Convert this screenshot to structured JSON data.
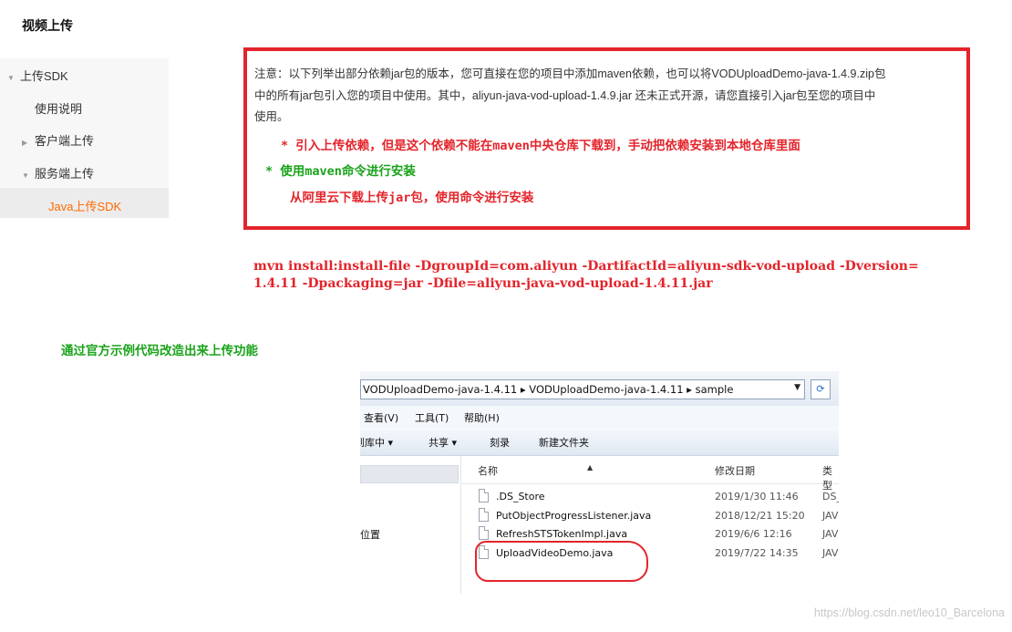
{
  "page_title": "视频上传",
  "sidebar": {
    "items": [
      {
        "label": "上传SDK",
        "arrow": "▼"
      },
      {
        "label": "使用说明",
        "arrow": ""
      },
      {
        "label": "客户端上传",
        "arrow": "▶"
      },
      {
        "label": "服务端上传",
        "arrow": "▼"
      },
      {
        "label": "Java上传SDK",
        "arrow": "",
        "active": true
      }
    ]
  },
  "note": {
    "line1": "注意：以下列举出部分依赖jar包的版本，您可直接在您的项目中添加maven依赖，也可以将VODUploadDemo-java-1.4.9.zip包",
    "line2": "中的所有jar包引入您的项目中使用。其中，aliyun-java-vod-upload-1.4.9.jar 还未正式开源，请您直接引入jar包至您的项目中",
    "line3": "使用。",
    "red_note": "* 引入上传依赖，但是这个依赖不能在maven中央仓库下载到，手动把依赖安装到本地仓库里面",
    "green_note": "* 使用maven命令进行安装",
    "red_note2": "从阿里云下载上传jar包，使用命令进行安装"
  },
  "command": {
    "line1": "mvn install:install-file -DgroupId=com.aliyun -DartifactId=aliyun-sdk-vod-upload -Dversion=",
    "line2": "1.4.11 -Dpackaging=jar -Dfile=aliyun-java-vod-upload-1.4.11.jar"
  },
  "section2_title": "通过官方示例代码改造出来上传功能",
  "explorer": {
    "address": "VODUploadDemo-java-1.4.11  ▸  VODUploadDemo-java-1.4.11  ▸  sample",
    "menu": [
      "查看(V)",
      "工具(T)",
      "帮助(H)"
    ],
    "toolbar": [
      "到库中 ▾",
      "共享 ▾",
      "刻录",
      "新建文件夹"
    ],
    "nav_location": "位置",
    "columns": {
      "name": "名称",
      "modified": "修改日期",
      "type": "类型"
    },
    "files": [
      {
        "name": ".DS_Store",
        "date": "2019/1/30 11:46",
        "type": "DS_"
      },
      {
        "name": "PutObjectProgressListener.java",
        "date": "2018/12/21 15:20",
        "type": "JAV"
      },
      {
        "name": "RefreshSTSTokenImpl.java",
        "date": "2019/6/6 12:16",
        "type": "JAV"
      },
      {
        "name": "UploadVideoDemo.java",
        "date": "2019/7/22 14:35",
        "type": "JAV"
      }
    ]
  },
  "watermark": "https://blog.csdn.net/leo10_Barcelona",
  "colors": {
    "accent_red": "#e3242b",
    "accent_green": "#1aa31a",
    "active_orange": "#ff6a00"
  }
}
